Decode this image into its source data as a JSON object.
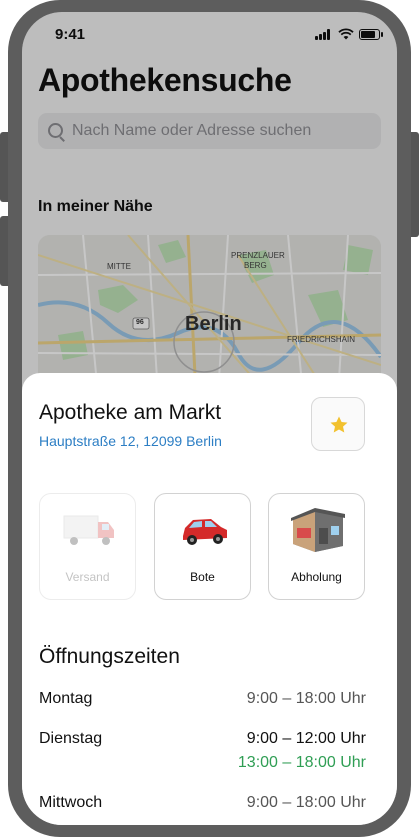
{
  "status_bar": {
    "time": "9:41"
  },
  "page_title": "Apothekensuche",
  "search": {
    "placeholder": "Nach Name oder Adresse suchen"
  },
  "nearby": {
    "heading": "In meiner Nähe",
    "map_labels": {
      "city": "Berlin",
      "mitte": "MITTE",
      "prenzlauer": "PRENZLAUER",
      "berg": "BERG",
      "friedrichshain": "FRIEDRICHSHAIN",
      "road": "96"
    }
  },
  "pharmacy": {
    "name": "Apotheke am Markt",
    "address": "Hauptstraße 12, 12099 Berlin",
    "favorite_icon": "star-icon"
  },
  "delivery_options": [
    {
      "label": "Versand",
      "icon": "truck-icon",
      "enabled": false
    },
    {
      "label": "Bote",
      "icon": "car-icon",
      "enabled": true
    },
    {
      "label": "Abholung",
      "icon": "store-icon",
      "enabled": true
    }
  ],
  "opening_hours": {
    "heading": "Öffnungszeiten",
    "days": [
      {
        "day": "Montag",
        "times": [
          "9:00 – 18:00 Uhr"
        ]
      },
      {
        "day": "Dienstag",
        "times": [
          "9:00 – 12:00 Uhr",
          "13:00 – 18:00 Uhr"
        ]
      },
      {
        "day": "Mittwoch",
        "times": [
          "9:00 – 18:00 Uhr"
        ]
      }
    ]
  },
  "colors": {
    "accent_link": "#2c7ec4",
    "open_now": "#2f9e54",
    "star": "#f2c12e"
  }
}
